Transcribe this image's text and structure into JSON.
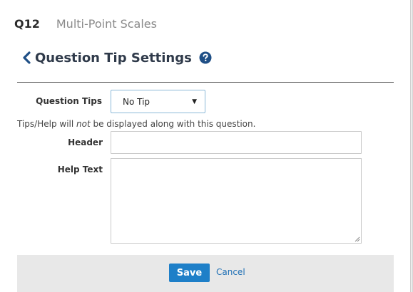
{
  "header": {
    "question_number": "Q12",
    "question_type": "Multi-Point Scales"
  },
  "settings": {
    "title": "Question Tip Settings",
    "back_icon": "chevron-left-icon",
    "help_icon": "question-circle-icon"
  },
  "form": {
    "question_tips_label": "Question Tips",
    "question_tips_value": "No Tip",
    "note_prefix": "Tips/Help will ",
    "note_emphasis": "not",
    "note_suffix": " be displayed along with this question.",
    "header_label": "Header",
    "header_value": "",
    "help_text_label": "Help Text",
    "help_text_value": ""
  },
  "footer": {
    "save_label": "Save",
    "cancel_label": "Cancel"
  },
  "colors": {
    "primary": "#1e7fc8",
    "link": "#1e6fb5",
    "title": "#2f3a4a",
    "footer_bg": "#e8e8e8"
  }
}
